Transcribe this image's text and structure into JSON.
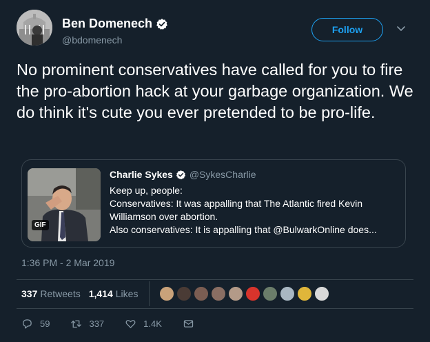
{
  "author": {
    "display_name": "Ben Domenech",
    "handle": "@bdomenech"
  },
  "follow_label": "Follow",
  "tweet_text": "No prominent conservatives have called for you to fire the pro-abortion hack at your garbage organization. We do think it's cute you ever pretended to be pro-life.",
  "quote": {
    "display_name": "Charlie Sykes",
    "handle": "@SykesCharlie",
    "lines": [
      "Keep up, people:",
      "Conservatives: It was appalling that The Atlantic fired Kevin",
      "Williamson over abortion.",
      "Also conservatives: It is appalling that @BulwarkOnline does..."
    ],
    "media_badge": "GIF"
  },
  "timestamp": "1:36 PM - 2 Mar 2019",
  "stats": {
    "retweets_count": "337",
    "retweets_label": "Retweets",
    "likes_count": "1,414",
    "likes_label": "Likes"
  },
  "likers_colors": [
    "#c9a27a",
    "#4a3b35",
    "#7b5d52",
    "#8a6e63",
    "#b39a88",
    "#d8342c",
    "#6b7d6a",
    "#a9b7c2",
    "#e0b63a",
    "#d9d9d9"
  ],
  "actions": {
    "replies": "59",
    "retweets": "337",
    "likes": "1.4K"
  },
  "colors": {
    "background": "#15202b",
    "accent": "#1da1f2",
    "secondary_text": "#8899a6",
    "border": "#38444d"
  }
}
